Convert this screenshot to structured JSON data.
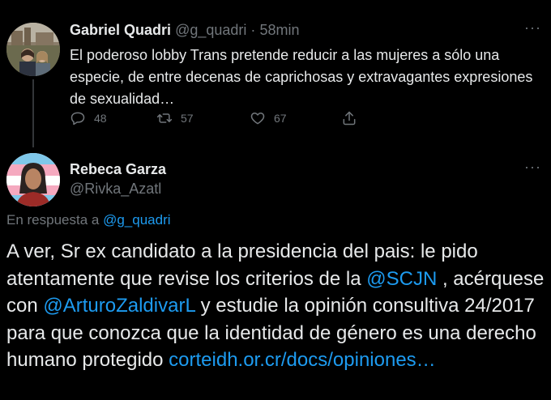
{
  "original_tweet": {
    "author_name": "Gabriel Quadri",
    "handle": "@g_quadri",
    "separator": "·",
    "time": "58min",
    "more_label": "···",
    "text": "El poderoso lobby Trans pretende reducir a las mujeres a sólo una especie, de entre decenas de caprichosas y extravagantes expresiones de sexualidad…",
    "actions": {
      "replies": "48",
      "retweets": "57",
      "likes": "67"
    }
  },
  "reply_tweet": {
    "author_name": "Rebeca Garza",
    "handle": "@Rivka_Azatl",
    "more_label": "···",
    "replying_prefix": "En respuesta a ",
    "replying_to": "@g_quadri",
    "text_parts": {
      "p1": "A ver, Sr ex candidato a la presidencia del pais: le pido atentamente que revise los criterios de la ",
      "mention1": "@SCJN",
      "p2": " , acérquese con ",
      "mention2": "@ArturoZaldivarL",
      "p3": " y estudie la opinión consultiva 24/2017 para que conozca que la identidad de género es una derecho humano protegido ",
      "link": "corteidh.or.cr/docs/opiniones…"
    }
  },
  "colors": {
    "background": "#000000",
    "text": "#e7e9ea",
    "muted": "#71767b",
    "link": "#1d9bf0"
  }
}
